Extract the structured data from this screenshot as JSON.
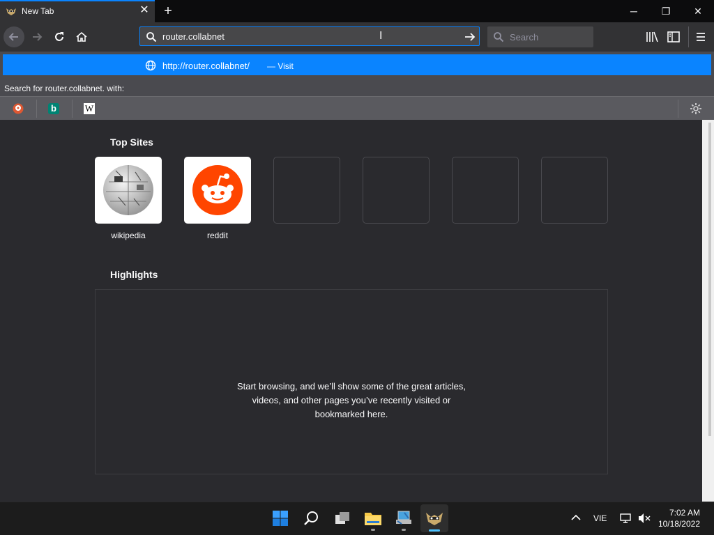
{
  "tab": {
    "title": "New Tab",
    "favicon": "firefox-raccoon-icon"
  },
  "window_controls": {
    "minimize": "─",
    "restore": "❐",
    "close": "✕"
  },
  "urlbar": {
    "value": "router.collabnet"
  },
  "searchbar": {
    "placeholder": "Search"
  },
  "dropdown": {
    "suggestion_url": "http://router.collabnet/",
    "suggestion_action": "— Visit",
    "search_label": "Search for router.collabnet. with:",
    "engines": [
      "duckduckgo",
      "bing",
      "wikipedia"
    ],
    "engine_glyphs": {
      "bing": "b",
      "wikipedia": "W"
    }
  },
  "top_sites": {
    "title": "Top Sites",
    "tiles": [
      {
        "label": "wikipedia"
      },
      {
        "label": "reddit"
      },
      {
        "label": ""
      },
      {
        "label": ""
      },
      {
        "label": ""
      },
      {
        "label": ""
      }
    ]
  },
  "highlights": {
    "title": "Highlights",
    "message_line1": "Start browsing, and we’ll show some of the great articles,",
    "message_line2": "videos, and other pages you’ve recently visited or",
    "message_line3": "bookmarked here."
  },
  "taskbar": {
    "language": "VIE",
    "time": "7:02 AM",
    "date": "10/18/2022"
  },
  "colors": {
    "accent": "#0a84ff",
    "background": "#2a2a2e",
    "reddit": "#ff4500"
  }
}
